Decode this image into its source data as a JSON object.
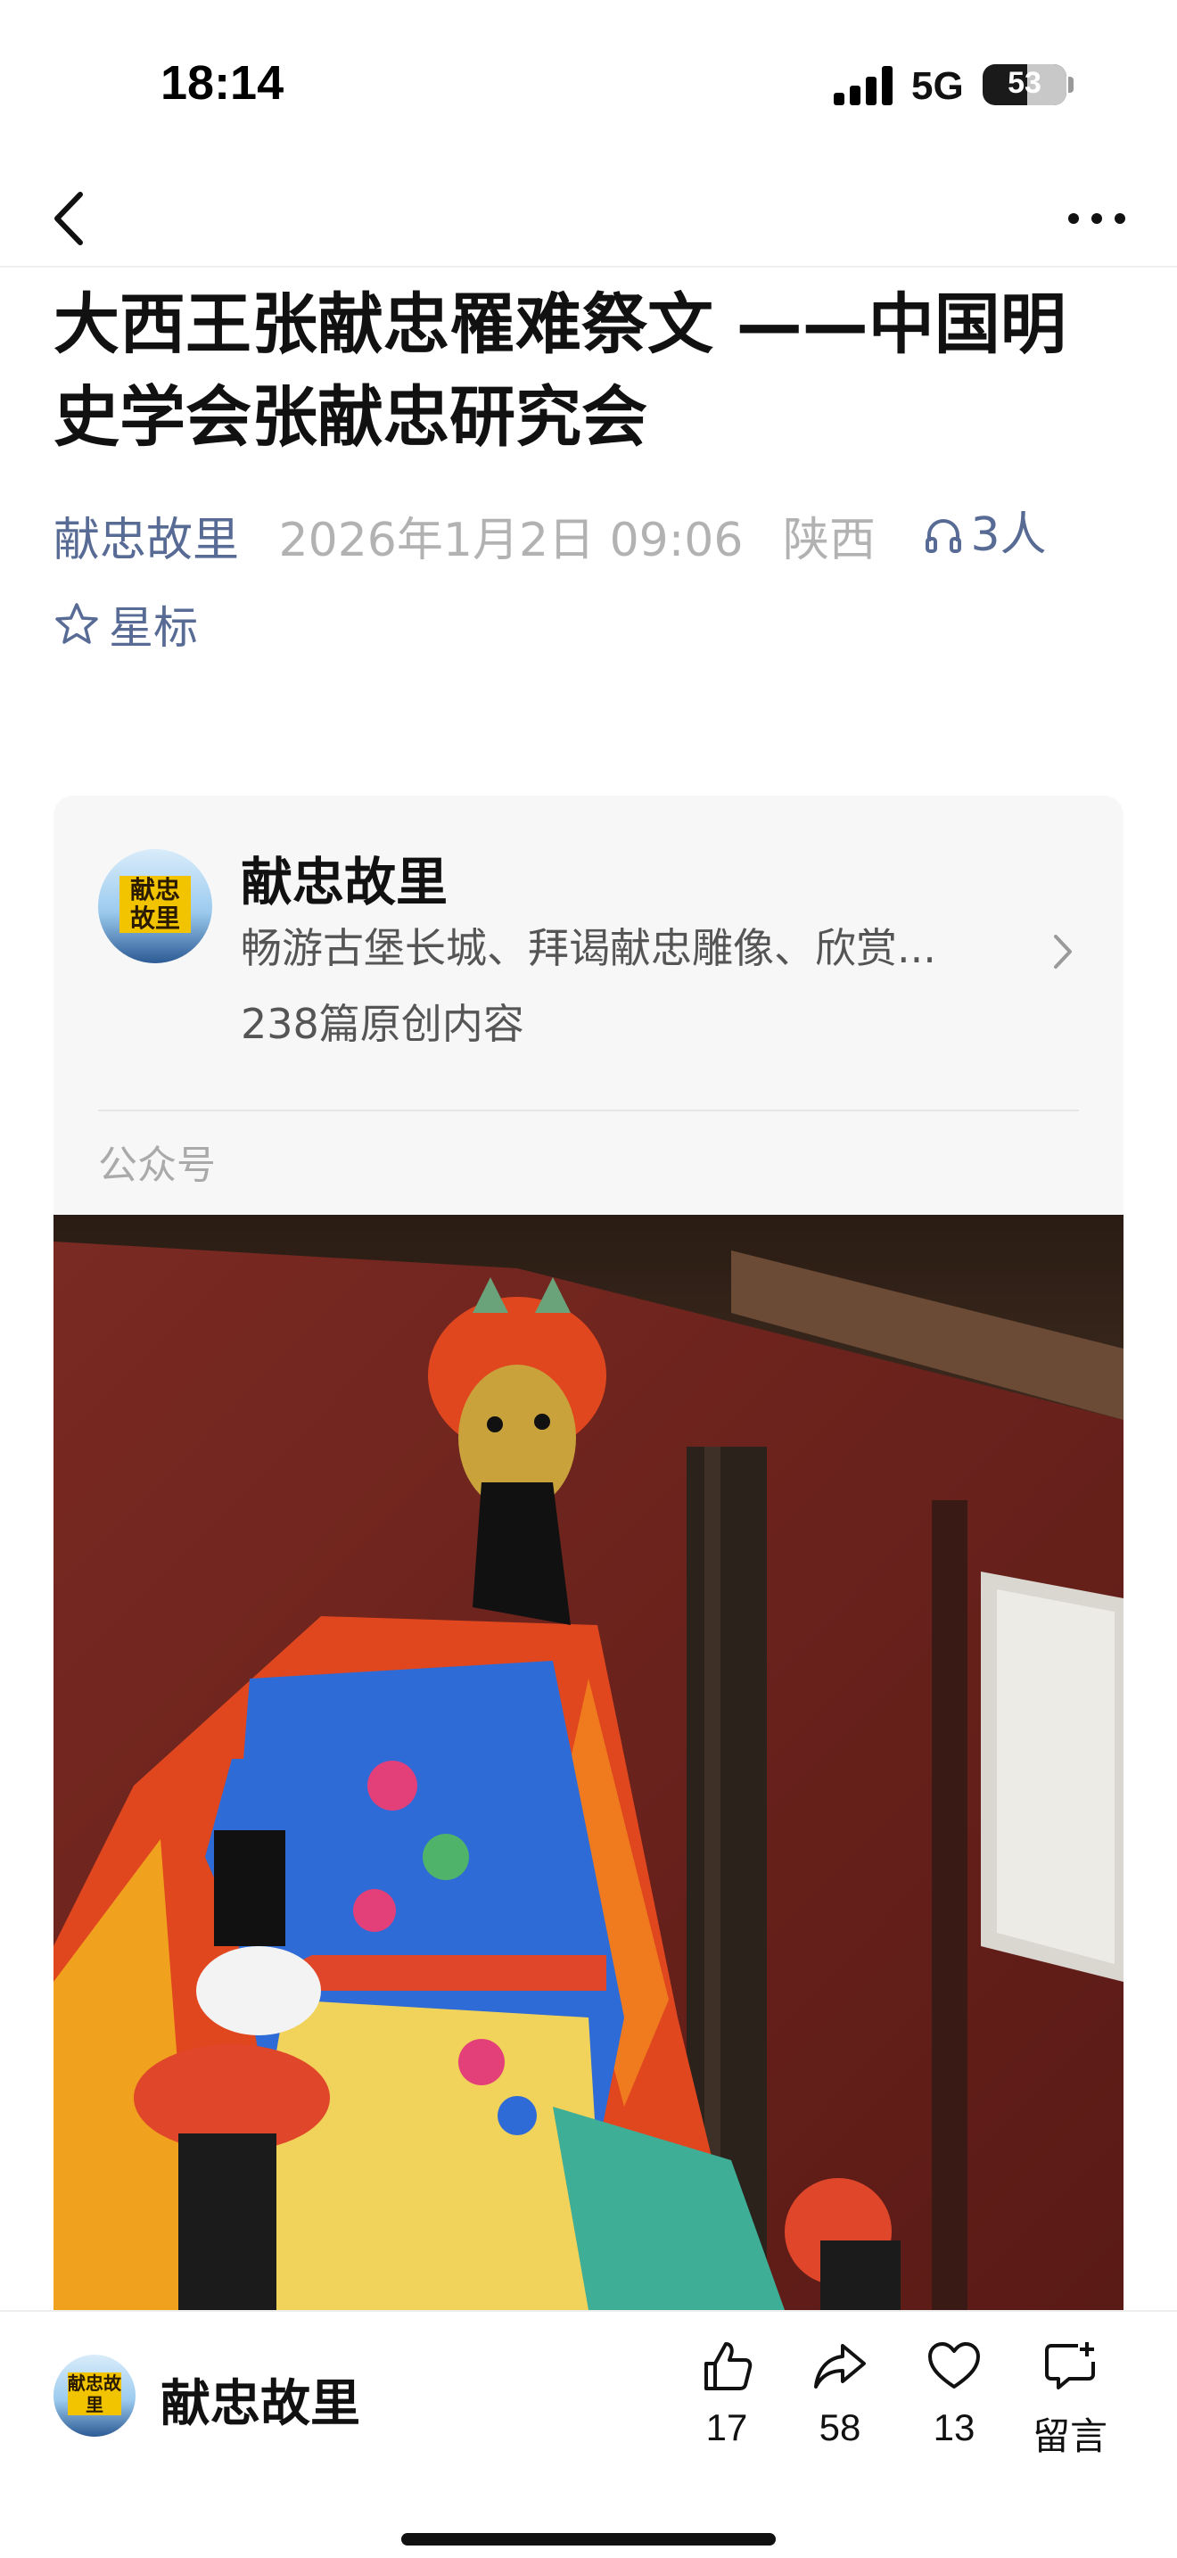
{
  "status_bar": {
    "time": "18:14",
    "network": "5G",
    "battery": "53",
    "battery_level": 0.53
  },
  "nav": {
    "back_icon": "chevron-left-icon",
    "more_icon": "more-horizontal-icon"
  },
  "article": {
    "title": "大西王张献忠罹难祭文 ——中国明史学会张献忠研究会",
    "author": "献忠故里",
    "date": "2026年1月2日 09:06",
    "location": "陕西",
    "listeners": "3人",
    "star_label": "星标"
  },
  "account_card": {
    "avatar_text": "献忠故里",
    "name": "献忠故里",
    "description": "畅游古堡长城、拜谒献忠雕像、欣赏...",
    "article_count": "238篇原创内容",
    "type_label": "公众号"
  },
  "bottom_bar": {
    "account_name": "献忠故里",
    "avatar_text": "献忠故里",
    "like_count": "17",
    "share_count": "58",
    "favorite_count": "13",
    "comment_label": "留言"
  },
  "colors": {
    "link": "#576b95",
    "meta_gray": "#b2b2b2",
    "card_bg": "#f7f7f7"
  }
}
